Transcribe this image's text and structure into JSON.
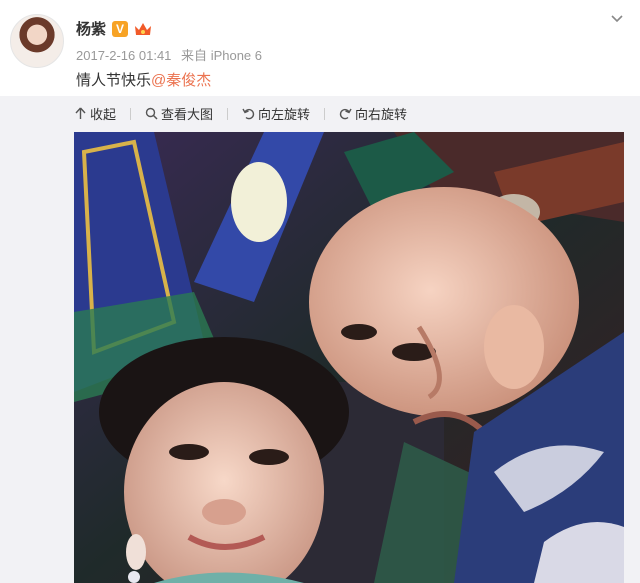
{
  "post": {
    "username": "杨紫",
    "verified_badge": "V",
    "timestamp": "2017-2-16 01:41",
    "source_prefix": "来自",
    "source_device": "iPhone 6",
    "text": "情人节快乐",
    "mention": "@秦俊杰"
  },
  "toolbar": {
    "collapse_label": "收起",
    "view_large_label": "查看大图",
    "rotate_left_label": "向左旋转",
    "rotate_right_label": "向右旋转"
  },
  "colors": {
    "mention": "#eb7350",
    "verified": "#f7a325"
  }
}
